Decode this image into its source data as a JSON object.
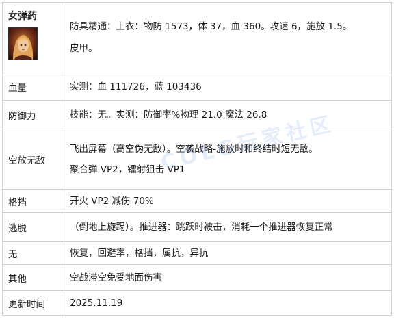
{
  "header": {
    "name": "女弹药",
    "portrait_icon": "female-launcher-portrait",
    "line1": "防具精通：上衣：物防 1573，体 37，血 360。攻速 6，施放 1.5。",
    "line2": "皮甲。"
  },
  "rows": [
    {
      "label": "血量",
      "lines": [
        "实测：血 111726，蓝 103436"
      ]
    },
    {
      "label": "防御力",
      "lines": [
        "技能：无。实测：防御率%物理 21.0 魔法 26.8"
      ]
    },
    {
      "label": "空放无敌",
      "lines": [
        "飞出屏幕（高空伪无敌）。空袭战略-施放时和终结时短无敌。",
        "聚合弹 VP2，镭射狙击 VP1"
      ]
    },
    {
      "label": "格挡",
      "lines": [
        "开火 VP2 减伤 70%"
      ]
    },
    {
      "label": "逃脱",
      "lines": [
        "（倒地上旋踢）。推进器：跳跃时被击，消耗一个推进器恢复正常"
      ]
    },
    {
      "label": "无",
      "lines": [
        "恢复，回避率，格挡，属抗，异抗"
      ]
    },
    {
      "label": "其他",
      "lines": [
        "空战滞空免受地面伤害"
      ]
    },
    {
      "label": "更新时间",
      "lines": [
        "2025.11.19"
      ]
    }
  ],
  "watermark": "COLG玩家社区"
}
